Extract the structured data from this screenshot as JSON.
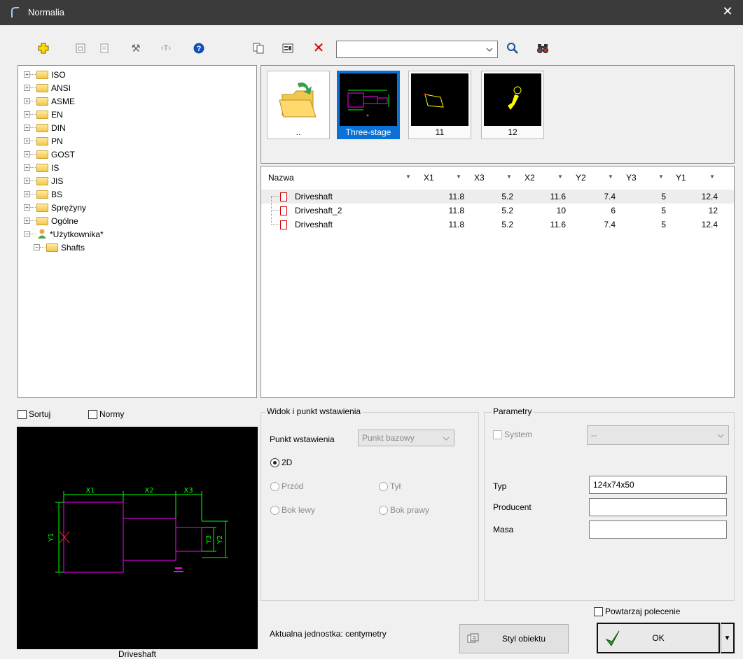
{
  "window": {
    "title": "Normalia",
    "close_glyph": "✕"
  },
  "toolbar": {
    "search_value": ""
  },
  "tree": {
    "items": [
      {
        "label": "ISO"
      },
      {
        "label": "ANSI"
      },
      {
        "label": "ASME"
      },
      {
        "label": "EN"
      },
      {
        "label": "DIN"
      },
      {
        "label": "PN"
      },
      {
        "label": "GOST"
      },
      {
        "label": "IS"
      },
      {
        "label": "JIS"
      },
      {
        "label": "BS"
      },
      {
        "label": "Sprężyny"
      },
      {
        "label": "Ogólne"
      },
      {
        "label": "*Użytkownika*"
      },
      {
        "label": "Shafts"
      }
    ]
  },
  "thumbnails": [
    {
      "label": "..",
      "icon": "folder-up-icon"
    },
    {
      "label": "Three-stage",
      "selected": true
    },
    {
      "label": "11"
    },
    {
      "label": "12"
    }
  ],
  "grid": {
    "columns": [
      "Nazwa",
      "X1",
      "X3",
      "X2",
      "Y2",
      "Y3",
      "Y1"
    ],
    "rows": [
      {
        "name": "Driveshaft",
        "x1": "11.8",
        "x3": "5.2",
        "x2": "11.6",
        "y2": "7.4",
        "y3": "5",
        "y1": "12.4"
      },
      {
        "name": "Driveshaft_2",
        "x1": "11.8",
        "x3": "5.2",
        "x2": "10",
        "y2": "6",
        "y3": "5",
        "y1": "12"
      },
      {
        "name": "Driveshaft",
        "x1": "11.8",
        "x3": "5.2",
        "x2": "11.6",
        "y2": "7.4",
        "y3": "5",
        "y1": "12.4"
      }
    ]
  },
  "options": {
    "sort_label": "Sortuj",
    "norms_label": "Normy"
  },
  "preview": {
    "caption": "Driveshaft",
    "dim_labels": {
      "x1": "X1",
      "x2": "X2",
      "x3": "X3",
      "y1": "Y1",
      "y2": "Y2",
      "y3": "Y3"
    }
  },
  "view_group": {
    "title": "Widok i punkt wstawienia",
    "insert_point_label": "Punkt wstawienia",
    "insert_point_value": "Punkt bazowy",
    "radio_2d": "2D",
    "radio_front": "Przód",
    "radio_back": "Tył",
    "radio_left": "Bok lewy",
    "radio_right": "Bok prawy"
  },
  "params_group": {
    "title": "Parametry",
    "system_label": "System",
    "system_value": "--",
    "typ_label": "Typ",
    "typ_value": "124x74x50",
    "producer_label": "Producent",
    "producer_value": "",
    "mass_label": "Masa",
    "mass_value": ""
  },
  "footer": {
    "unit_text": "Aktualna jednostka: centymetry",
    "style_button": "Styl obiektu",
    "repeat_label": "Powtarzaj polecenie",
    "ok_button": "OK"
  },
  "colors": {
    "selection": "#0a72d6",
    "titlebar": "#3b3b3b",
    "cad_green": "#00ff00",
    "cad_magenta": "#ff00ff"
  }
}
